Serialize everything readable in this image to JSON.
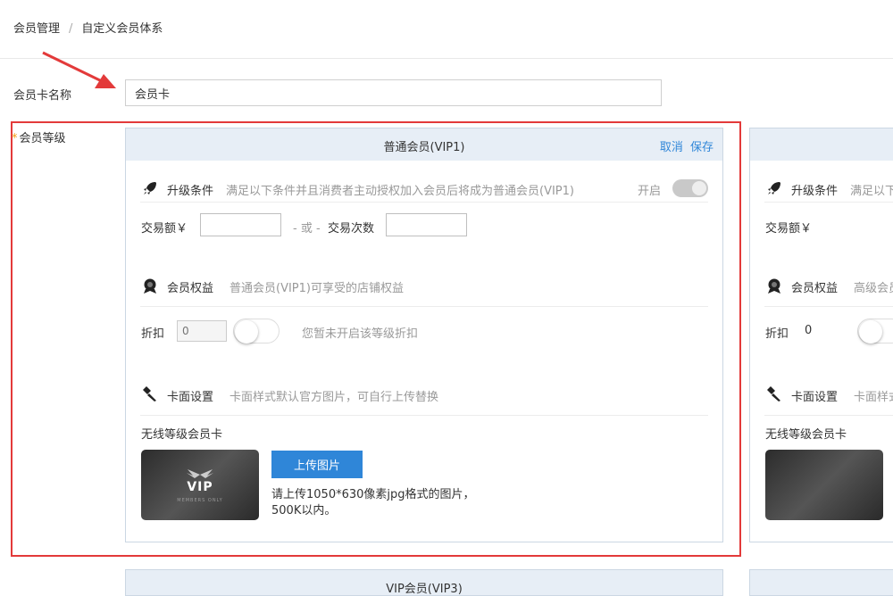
{
  "breadcrumb": {
    "items": [
      "会员管理",
      "自定义会员体系"
    ],
    "separator": "/"
  },
  "form": {
    "card_name_label": "会员卡名称",
    "card_name_value": "会员卡",
    "level_label": "会员等级",
    "required_mark": "*"
  },
  "levels": [
    {
      "title": "普通会员(VIP1)",
      "cancel": "取消",
      "save": "保存",
      "upgrade": {
        "title": "升级条件",
        "desc": "满足以下条件并且消费者主动授权加入会员后将成为普通会员(VIP1)",
        "toggle_label": "开启",
        "amount_label": "交易额￥",
        "or_label": "- 或 -",
        "count_label": "交易次数"
      },
      "rights": {
        "title": "会员权益",
        "desc": "普通会员(VIP1)可享受的店铺权益",
        "discount_label": "折扣",
        "discount_placeholder": "0",
        "discount_hint": "您暂未开启该等级折扣"
      },
      "cardface": {
        "title": "卡面设置",
        "desc": "卡面样式默认官方图片，可自行上传替换",
        "wireless_label": "无线等级会员卡",
        "card_text": "VIP",
        "card_subtext": "MEMBERS ONLY",
        "upload_button": "上传图片",
        "upload_hint_1": "请上传1050*630像素jpg格式的图片，",
        "upload_hint_2": "500K以内。"
      }
    },
    {
      "upgrade": {
        "title": "升级条件",
        "desc": "满足以下",
        "amount_label": "交易额￥"
      },
      "rights": {
        "title": "会员权益",
        "desc": "高级会员",
        "discount_label": "折扣",
        "discount_value": "0"
      },
      "cardface": {
        "title": "卡面设置",
        "desc": "卡面样式",
        "wireless_label": "无线等级会员卡"
      }
    },
    {
      "title": "VIP会员(VIP3)"
    }
  ],
  "colors": {
    "accent": "#2f86d8",
    "highlight_box": "#e33a3a",
    "card_header": "#e7eef6",
    "required": "#f39c12"
  }
}
